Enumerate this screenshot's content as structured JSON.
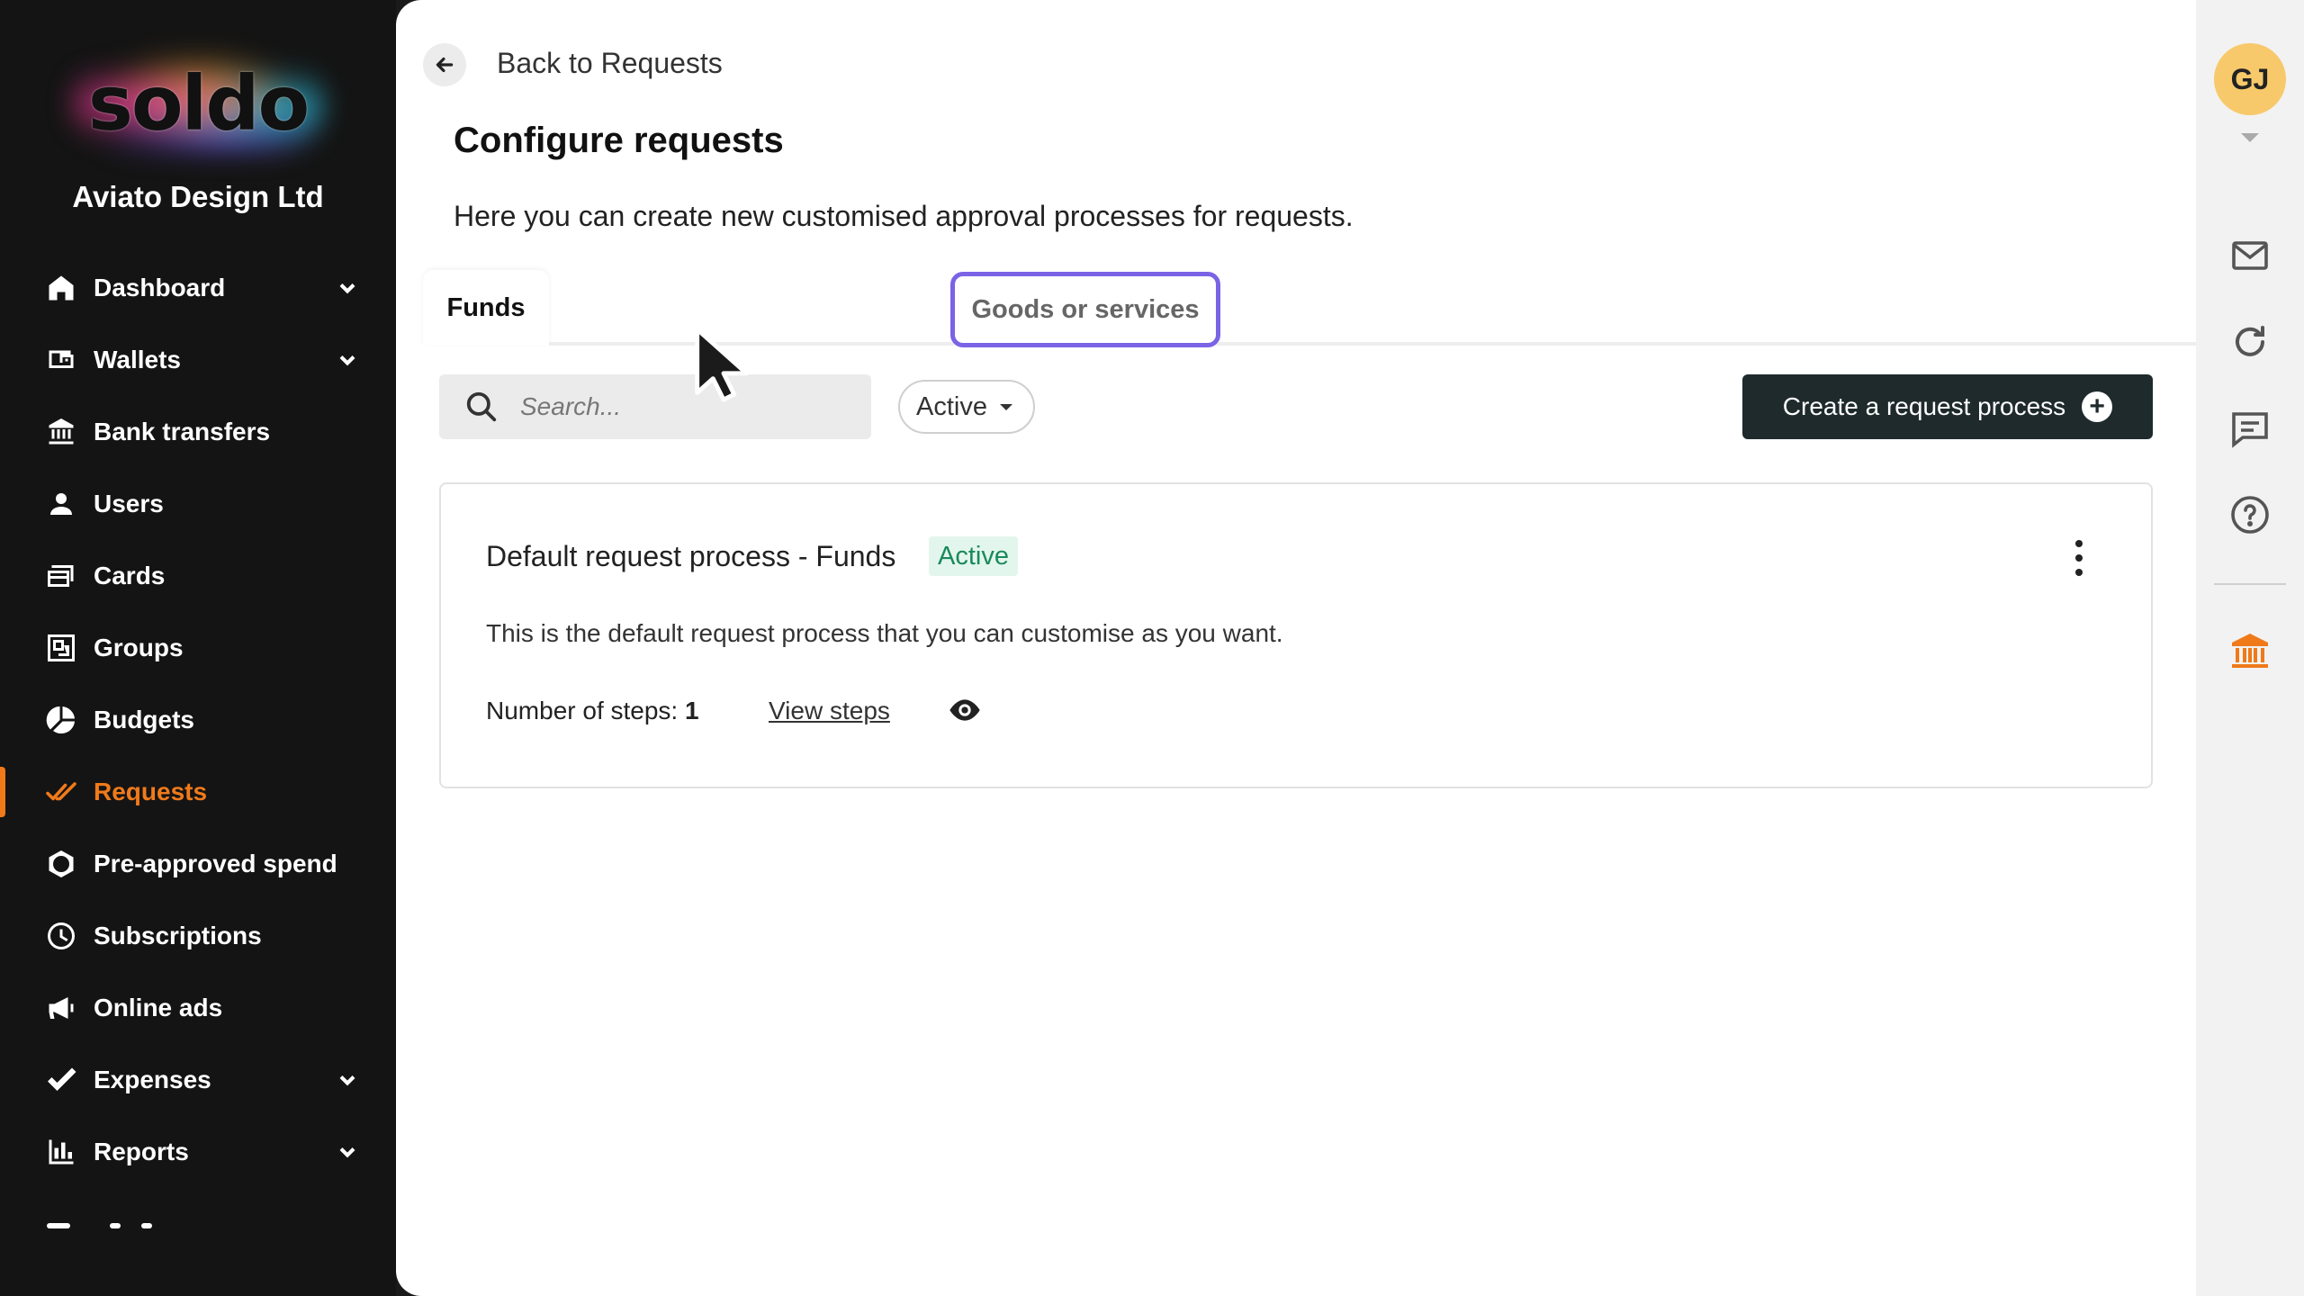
{
  "brand": {
    "logo_text": "soldo",
    "company": "Aviato Design Ltd"
  },
  "sidebar": {
    "items": [
      {
        "label": "Dashboard",
        "icon": "home-icon",
        "has_chevron": true
      },
      {
        "label": "Wallets",
        "icon": "wallet-icon",
        "has_chevron": true
      },
      {
        "label": "Bank transfers",
        "icon": "bank-transfer-icon",
        "has_chevron": false
      },
      {
        "label": "Users",
        "icon": "user-icon",
        "has_chevron": false
      },
      {
        "label": "Cards",
        "icon": "cards-icon",
        "has_chevron": false
      },
      {
        "label": "Groups",
        "icon": "groups-icon",
        "has_chevron": false
      },
      {
        "label": "Budgets",
        "icon": "budget-pie-icon",
        "has_chevron": false
      },
      {
        "label": "Requests",
        "icon": "requests-check-icon",
        "has_chevron": false,
        "active": true
      },
      {
        "label": "Pre-approved spend",
        "icon": "hexagon-icon",
        "has_chevron": false
      },
      {
        "label": "Subscriptions",
        "icon": "clock-icon",
        "has_chevron": false
      },
      {
        "label": "Online ads",
        "icon": "megaphone-icon",
        "has_chevron": false
      },
      {
        "label": "Expenses",
        "icon": "checkmark-icon",
        "has_chevron": true
      },
      {
        "label": "Reports",
        "icon": "bar-chart-icon",
        "has_chevron": true
      }
    ]
  },
  "header": {
    "back_label": "Back to Requests",
    "title": "Configure requests",
    "description": "Here you can create new customised approval processes for requests."
  },
  "tabs": [
    {
      "label": "Funds",
      "selected": true
    },
    {
      "label": "Goods or services",
      "selected": false,
      "highlighted": true
    }
  ],
  "toolbar": {
    "search_placeholder": "Search...",
    "status_filter": "Active",
    "create_button": "Create a request process"
  },
  "process_card": {
    "title": "Default request process - Funds",
    "status": "Active",
    "description": "This is the default request process that you can customise as you want.",
    "steps_label": "Number of steps:",
    "steps_count": "1",
    "view_steps": "View steps"
  },
  "rail": {
    "avatar_initials": "GJ",
    "icons": [
      "mail-icon",
      "refresh-icon",
      "chat-icon",
      "help-icon",
      "bank-icon"
    ]
  },
  "colors": {
    "accent": "#f07a1a",
    "tab_highlight": "#7b63e6",
    "active_badge_bg": "#e3f6ee",
    "active_badge_text": "#1a8a5a",
    "primary_button": "#1f2a2c",
    "avatar": "#f7c96a"
  }
}
